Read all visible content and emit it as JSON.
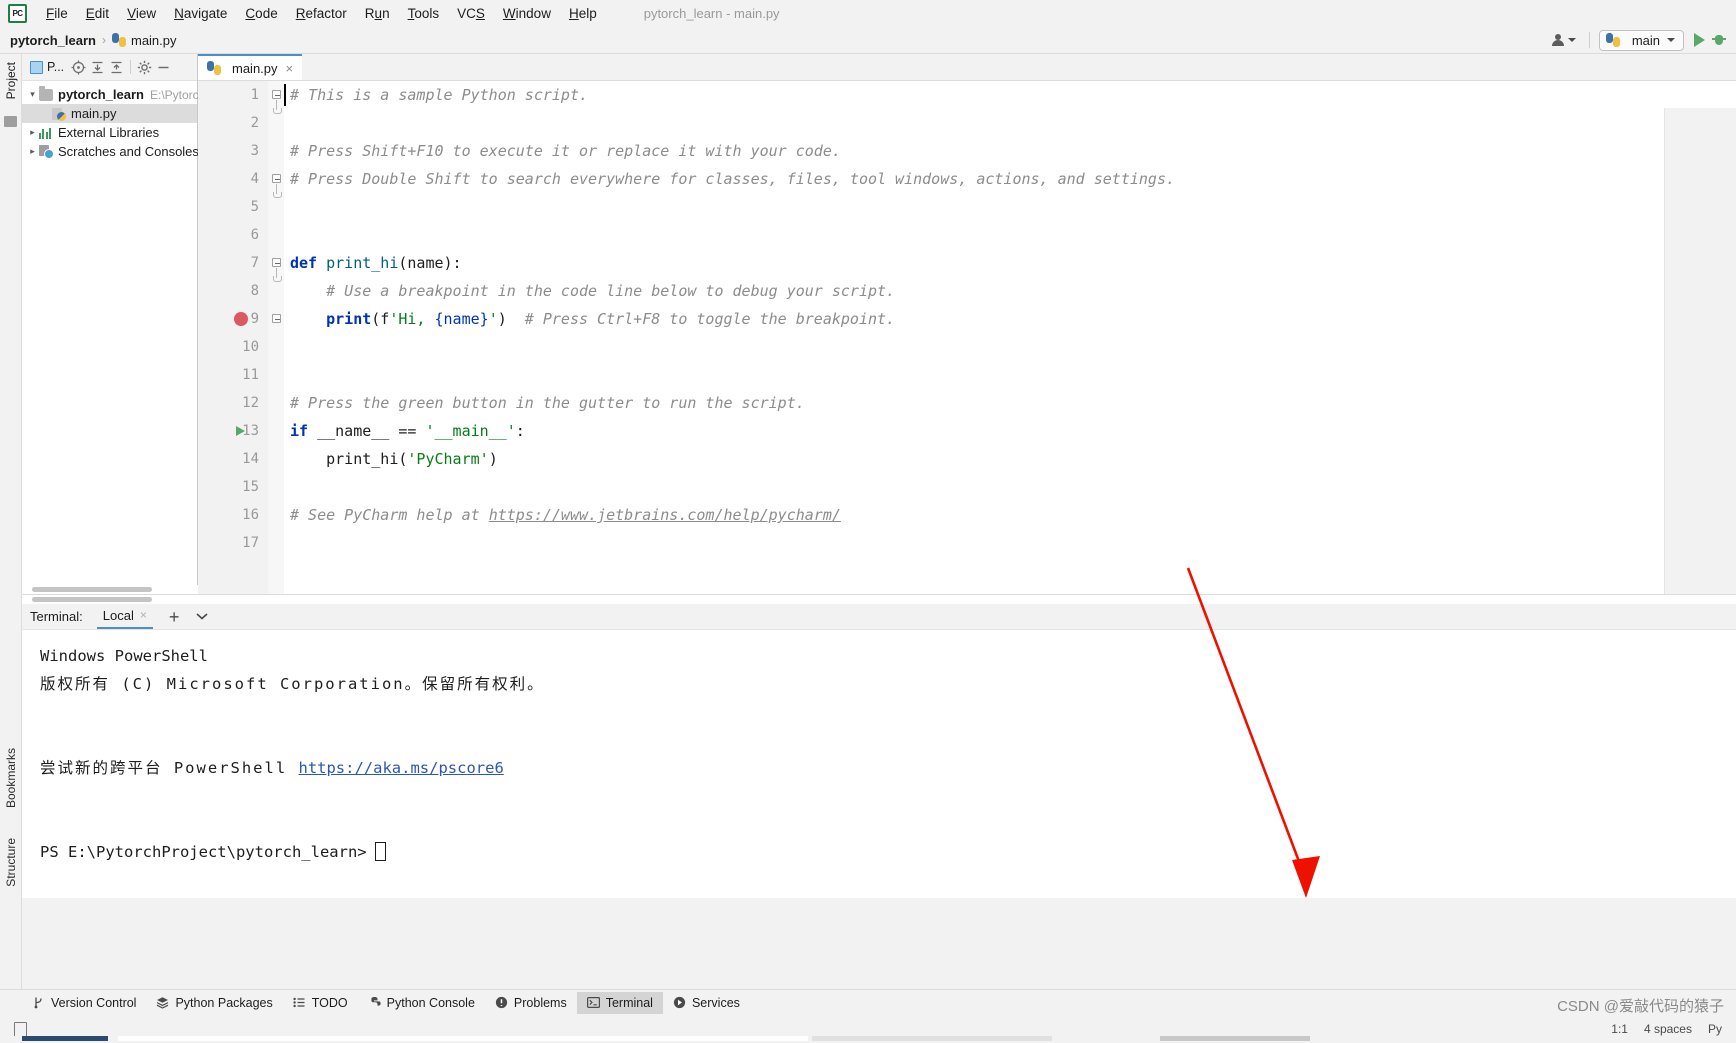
{
  "window": {
    "title": "pytorch_learn - main.py",
    "logo_text": "PC"
  },
  "menubar": {
    "items": [
      {
        "label": "File"
      },
      {
        "label": "Edit"
      },
      {
        "label": "View"
      },
      {
        "label": "Navigate"
      },
      {
        "label": "Code"
      },
      {
        "label": "Refactor"
      },
      {
        "label": "Run"
      },
      {
        "label": "Tools"
      },
      {
        "label": "VCS"
      },
      {
        "label": "Window"
      },
      {
        "label": "Help"
      }
    ]
  },
  "breadcrumb": {
    "project": "pytorch_learn",
    "separator": "›",
    "file": "main.py"
  },
  "toolbar": {
    "run_config": "main",
    "run_tooltip": "Run",
    "debug_tooltip": "Debug"
  },
  "rails": {
    "left_top": "Project",
    "left_bookmarks": "Bookmarks",
    "left_structure": "Structure"
  },
  "project_panel": {
    "tab_label": "P...",
    "tree": [
      {
        "label": "pytorch_learn",
        "sub": "E:\\PytorchPr",
        "icon": "folder-icon",
        "expanded": true,
        "bold": true,
        "selected": false,
        "depth": 0
      },
      {
        "label": "main.py",
        "sub": "",
        "icon": "python-file-icon",
        "expanded": false,
        "bold": false,
        "selected": true,
        "depth": 1
      },
      {
        "label": "External Libraries",
        "sub": "",
        "icon": "libraries-icon",
        "expanded": false,
        "bold": false,
        "selected": false,
        "depth": 0
      },
      {
        "label": "Scratches and Consoles",
        "sub": "",
        "icon": "scratches-icon",
        "expanded": false,
        "bold": false,
        "selected": false,
        "depth": 0
      }
    ]
  },
  "editor": {
    "tab_label": "main.py",
    "close_glyph": "×",
    "cursor_line": 1,
    "breakpoint_line": 9,
    "run_gutter_line": 13,
    "lines": [
      {
        "n": 1,
        "segments": [
          {
            "t": "# This is a sample Python script.",
            "c": "c-comment"
          }
        ]
      },
      {
        "n": 2,
        "segments": []
      },
      {
        "n": 3,
        "segments": [
          {
            "t": "# Press Shift+F10 to execute it or replace it with your code.",
            "c": "c-comment"
          }
        ]
      },
      {
        "n": 4,
        "segments": [
          {
            "t": "# Press Double Shift to search everywhere for classes, files, tool windows, actions, and settings.",
            "c": "c-comment"
          }
        ]
      },
      {
        "n": 5,
        "segments": []
      },
      {
        "n": 6,
        "segments": []
      },
      {
        "n": 7,
        "segments": [
          {
            "t": "def ",
            "c": "c-kw"
          },
          {
            "t": "print_hi",
            "c": "c-fn"
          },
          {
            "t": "(name):",
            "c": "c-plain"
          }
        ]
      },
      {
        "n": 8,
        "segments": [
          {
            "t": "    # Use a breakpoint in the code line below to debug your script.",
            "c": "c-comment"
          }
        ]
      },
      {
        "n": 9,
        "segments": [
          {
            "t": "    ",
            "c": "c-plain"
          },
          {
            "t": "print",
            "c": "c-kw"
          },
          {
            "t": "(f",
            "c": "c-plain"
          },
          {
            "t": "'Hi, ",
            "c": "c-str"
          },
          {
            "t": "{name}",
            "c": "c-strbrace"
          },
          {
            "t": "'",
            "c": "c-str"
          },
          {
            "t": ")",
            "c": "c-plain"
          },
          {
            "t": "  # Press Ctrl+F8 to toggle the breakpoint.",
            "c": "c-comment"
          }
        ]
      },
      {
        "n": 10,
        "segments": []
      },
      {
        "n": 11,
        "segments": []
      },
      {
        "n": 12,
        "segments": [
          {
            "t": "# Press the green button in the gutter to run the script.",
            "c": "c-comment"
          }
        ]
      },
      {
        "n": 13,
        "segments": [
          {
            "t": "if ",
            "c": "c-kw"
          },
          {
            "t": "__name__ ",
            "c": "c-ident"
          },
          {
            "t": "== ",
            "c": "c-plain"
          },
          {
            "t": "'__main__'",
            "c": "c-str"
          },
          {
            "t": ":",
            "c": "c-plain"
          }
        ]
      },
      {
        "n": 14,
        "segments": [
          {
            "t": "    print_hi(",
            "c": "c-plain"
          },
          {
            "t": "'PyCharm'",
            "c": "c-str"
          },
          {
            "t": ")",
            "c": "c-plain"
          }
        ]
      },
      {
        "n": 15,
        "segments": []
      },
      {
        "n": 16,
        "segments": [
          {
            "t": "# See PyCharm help at ",
            "c": "c-comment"
          },
          {
            "t": "https://www.jetbrains.com/help/pycharm/",
            "c": "c-link"
          }
        ]
      },
      {
        "n": 17,
        "segments": []
      }
    ]
  },
  "terminal": {
    "header_label": "Terminal:",
    "tab_label": "Local",
    "close_glyph": "×",
    "add_glyph": "+",
    "lines": [
      {
        "text": "Windows PowerShell",
        "type": "plain"
      },
      {
        "text": "版权所有 (C) Microsoft Corporation。保留所有权利。",
        "type": "cjk"
      },
      {
        "text": "",
        "type": "plain"
      },
      {
        "text": "",
        "type": "plain"
      },
      {
        "pre": "尝试新的跨平台 PowerShell ",
        "link": "https://aka.ms/pscore6",
        "type": "link"
      },
      {
        "text": "",
        "type": "plain"
      },
      {
        "text": "",
        "type": "plain"
      },
      {
        "prompt": "PS E:\\PytorchProject\\pytorch_learn>",
        "type": "prompt"
      }
    ]
  },
  "toolwindow_bar": {
    "buttons": [
      {
        "label": "Version Control",
        "icon": "branch-icon",
        "active": false
      },
      {
        "label": "Python Packages",
        "icon": "packages-icon",
        "active": false
      },
      {
        "label": "TODO",
        "icon": "todo-list-icon",
        "active": false
      },
      {
        "label": "Python Console",
        "icon": "python-console-icon",
        "active": false
      },
      {
        "label": "Problems",
        "icon": "problems-icon",
        "active": false
      },
      {
        "label": "Terminal",
        "icon": "terminal-icon",
        "active": true
      },
      {
        "label": "Services",
        "icon": "services-icon",
        "active": false
      }
    ]
  },
  "status_bar": {
    "position": "1:1",
    "indent": "4 spaces",
    "encoding": "Py"
  },
  "watermark": {
    "text": "CSDN @爱敲代码的猿子"
  },
  "colors": {
    "accent_blue": "#4a90c4",
    "run_green": "#59a869",
    "breakpoint_red": "#db5860",
    "keyword_blue": "#0033b3",
    "string_green": "#067d17",
    "comment_gray": "#8c8c8c",
    "annotation_red": "#ee1100",
    "current_line": "#fdf9e7",
    "breakpoint_row": "#fbe8e8"
  }
}
